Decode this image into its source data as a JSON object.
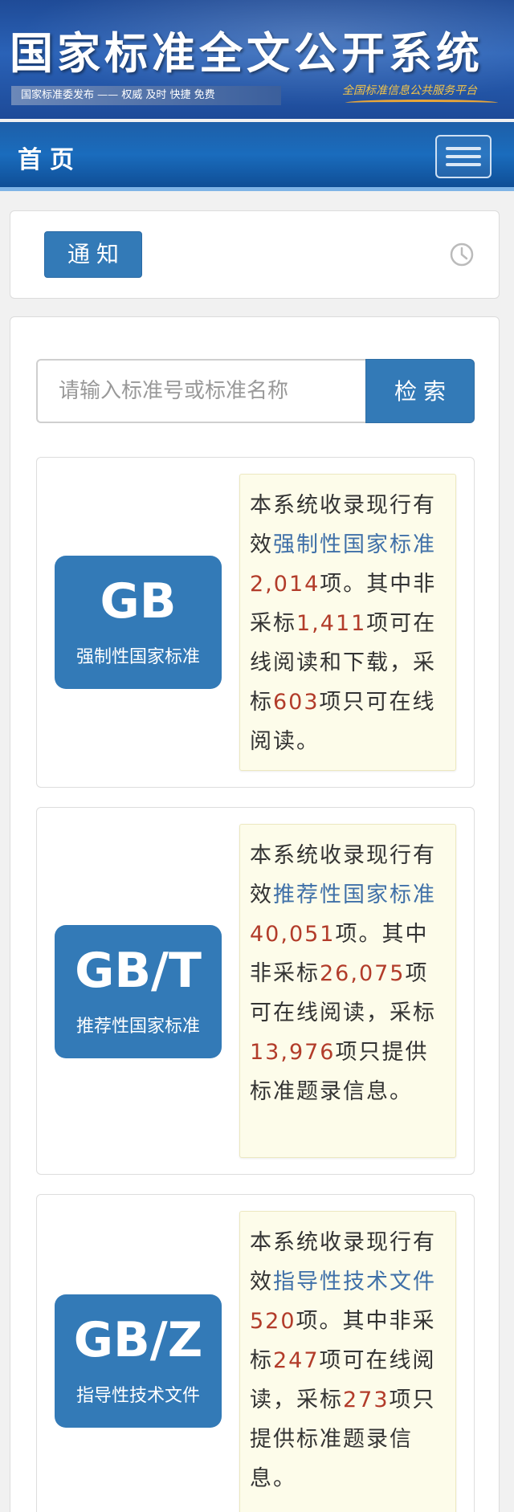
{
  "banner": {
    "title": "国家标准全文公开系统",
    "slogan": "国家标准委发布 —— 权威 及时 快捷 免费",
    "subtitle": "全国标准信息公共服务平台"
  },
  "nav": {
    "title": "首页",
    "menu_icon": "hamburger-menu-icon"
  },
  "notice": {
    "label": "通知",
    "clock_icon": "clock-icon"
  },
  "search": {
    "placeholder": "请输入标准号或标准名称",
    "button_label": "检索"
  },
  "standards": [
    {
      "code": "GB",
      "name": "强制性国家标准",
      "desc_prefix": "本系统收录现行有效",
      "desc_kw": "强制性国家标准",
      "total": "2,014",
      "s1": "项。其中非采标",
      "n1": "1,411",
      "s2": "项可在线阅读和下载，采标",
      "n2": "603",
      "s3": "项只可在线阅读。"
    },
    {
      "code": "GB/T",
      "name": "推荐性国家标准",
      "desc_prefix": "本系统收录现行有效",
      "desc_kw": "推荐性国家标准",
      "total": "40,051",
      "s1": "项。其中非采标",
      "n1": "26,075",
      "s2": "项可在线阅读，采标",
      "n2": "13,976",
      "s3": "项只提供标准题录信息。"
    },
    {
      "code": "GB/Z",
      "name": "指导性技术文件",
      "desc_prefix": "本系统收录现行有效",
      "desc_kw": "指导性技术文件",
      "total": "520",
      "s1": "项。其中非采标",
      "n1": "247",
      "s2": "项可在线阅读，采标",
      "n2": "273",
      "s3": "项只提供标准题录信息。"
    }
  ],
  "colors": {
    "primary": "#337ab7",
    "keyword": "#3f70a8",
    "number": "#b23c2a",
    "desc_bg": "#fdfcea"
  }
}
